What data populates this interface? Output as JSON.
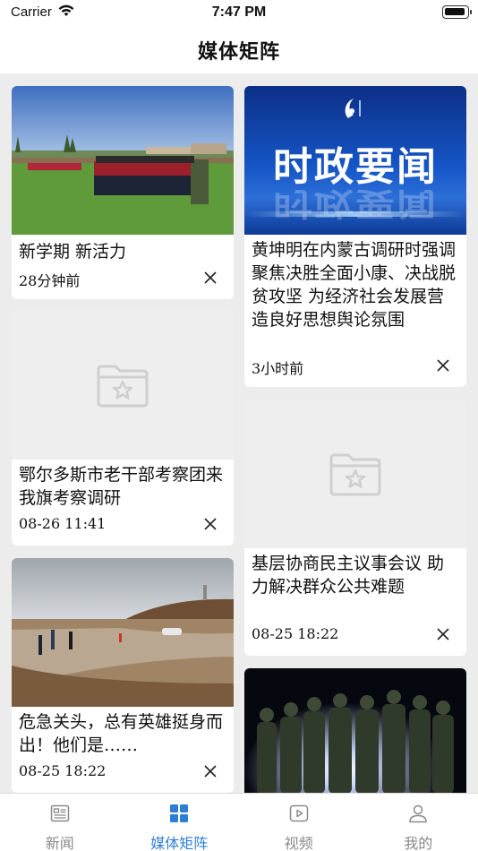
{
  "status": {
    "carrier": "Carrier",
    "time": "7:47 PM",
    "battery_level": 0.95
  },
  "header": {
    "title": "媒体矩阵"
  },
  "feed": [
    {
      "title": "新学期  新活力",
      "time": "28分钟前",
      "image": "students-in-field-photo"
    },
    {
      "title": "黄坤明在内蒙古调研时强调  聚焦决胜全面小康、决战脱贫攻坚  为经济社会发展营造良好思想舆论氛围",
      "time": "3小时前",
      "image": "news-banner-image",
      "banner_text": "时政要闻"
    },
    {
      "title": "鄂尔多斯市老干部考察团来我旗考察调研",
      "time": "08-26  11:41",
      "image": "placeholder-folder-icon"
    },
    {
      "title": "基层协商民主议事会议  助力解决群众公共难题",
      "time": "08-25  18:22",
      "image": "placeholder-folder-icon"
    },
    {
      "title": "危急关头，总有英雄挺身而出！他们是……",
      "time": "08-25  18:22",
      "image": "flood-rescue-photo"
    },
    {
      "title": "",
      "time": "",
      "image": "soldiers-night-photo"
    }
  ],
  "tabs": [
    {
      "label": "新闻",
      "icon": "news-icon",
      "active": false
    },
    {
      "label": "媒体矩阵",
      "icon": "grid-icon",
      "active": true
    },
    {
      "label": "视频",
      "icon": "video-play-icon",
      "active": false
    },
    {
      "label": "我的",
      "icon": "person-icon",
      "active": false
    }
  ],
  "colors": {
    "accent": "#2e7ed8",
    "background": "#ececec",
    "inactive_tab": "#888888"
  }
}
